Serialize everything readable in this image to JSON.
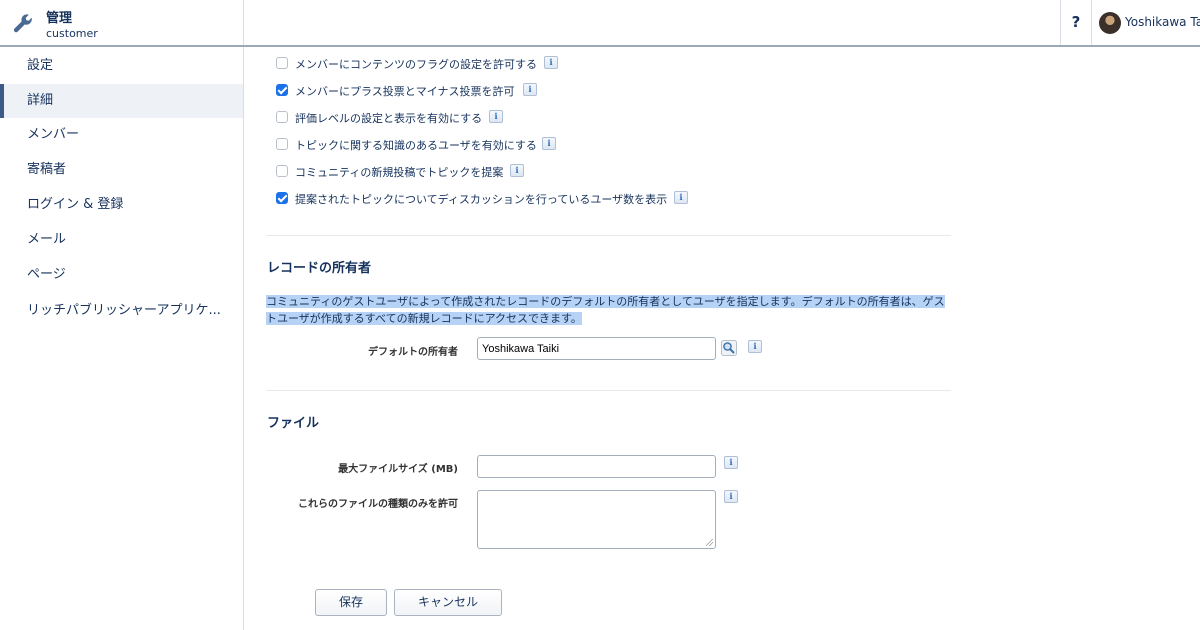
{
  "header": {
    "title": "管理",
    "subtitle": "customer",
    "help_label": "?",
    "user_name": "Yoshikawa Ta"
  },
  "sidebar": {
    "items": [
      {
        "label": "設定",
        "active": false
      },
      {
        "label": "詳細",
        "active": true
      },
      {
        "label": "メンバー",
        "active": false
      },
      {
        "label": "寄稿者",
        "active": false
      },
      {
        "label": "ログイン & 登録",
        "active": false
      },
      {
        "label": "メール",
        "active": false
      },
      {
        "label": "ページ",
        "active": false
      },
      {
        "label": "リッチパブリッシャーアプリケ...",
        "active": false
      }
    ]
  },
  "settings": {
    "checkboxes": [
      {
        "label": "メンバーにコンテンツのフラグの設定を許可する",
        "checked": false
      },
      {
        "label": "メンバーにプラス投票とマイナス投票を許可",
        "checked": true
      },
      {
        "label": "評価レベルの設定と表示を有効にする",
        "checked": false
      },
      {
        "label": "トピックに関する知識のあるユーザを有効にする",
        "checked": false
      },
      {
        "label": "コミュニティの新規投稿でトピックを提案",
        "checked": false
      },
      {
        "label": "提案されたトピックについてディスカッションを行っているユーザ数を表示",
        "checked": true
      }
    ],
    "info_glyph": "i"
  },
  "record_owner": {
    "title": "レコードの所有者",
    "description": "コミュニティのゲストユーザによって作成されたレコードのデフォルトの所有者としてユーザを指定します。デフォルトの所有者は、ゲストユーザが作成するすべての新規レコードにアクセスできます。",
    "default_owner_label": "デフォルトの所有者",
    "default_owner_value": "Yoshikawa Taiki"
  },
  "files": {
    "title": "ファイル",
    "max_size_label": "最大ファイルサイズ (MB)",
    "max_size_value": "",
    "allowed_types_label": "これらのファイルの種類のみを許可",
    "allowed_types_value": ""
  },
  "actions": {
    "save_label": "保存",
    "cancel_label": "キャンセル"
  },
  "colors": {
    "accent": "#1b72e8",
    "nav_active_bar": "#3e5a86",
    "selection_highlight": "#b6d3f5"
  }
}
